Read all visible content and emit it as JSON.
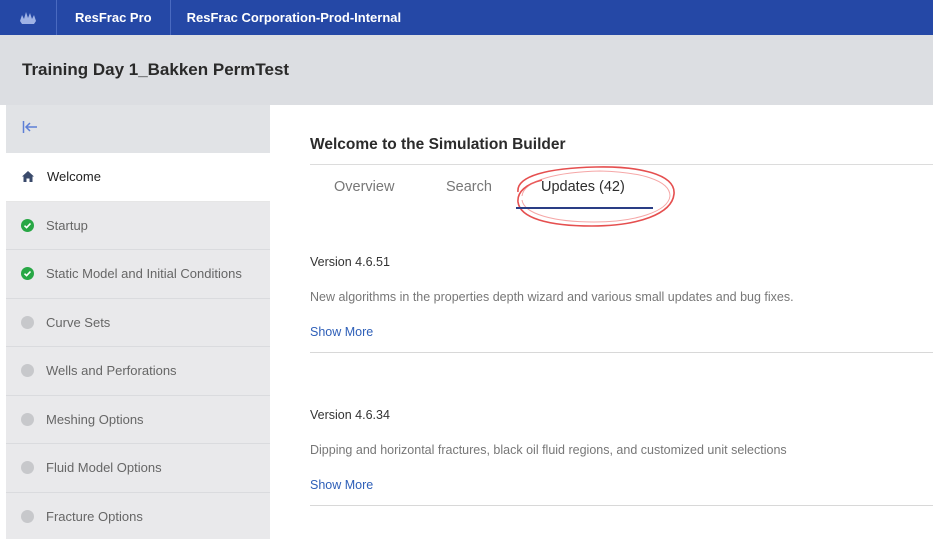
{
  "topbar": {
    "logo_icon": "resfrac-logo-icon",
    "product": "ResFrac Pro",
    "organization": "ResFrac Corporation-Prod-Internal",
    "bg_color": "#2548a6"
  },
  "project": {
    "title": "Training Day 1_Bakken PermTest"
  },
  "sidebar": {
    "collapse_icon": "collapse-left-icon",
    "items": [
      {
        "label": "Welcome",
        "status": "active",
        "icon": "home-icon"
      },
      {
        "label": "Startup",
        "status": "complete",
        "icon": "check-circle-icon"
      },
      {
        "label": "Static Model and Initial Conditions",
        "status": "complete",
        "icon": "check-circle-icon"
      },
      {
        "label": "Curve Sets",
        "status": "incomplete",
        "icon": "gray-dot-icon"
      },
      {
        "label": "Wells and Perforations",
        "status": "incomplete",
        "icon": "gray-dot-icon"
      },
      {
        "label": "Meshing Options",
        "status": "incomplete",
        "icon": "gray-dot-icon"
      },
      {
        "label": "Fluid Model Options",
        "status": "incomplete",
        "icon": "gray-dot-icon"
      },
      {
        "label": "Fracture Options",
        "status": "incomplete",
        "icon": "gray-dot-icon"
      }
    ]
  },
  "main": {
    "title": "Welcome to the Simulation Builder",
    "tabs": [
      {
        "label": "Overview",
        "active": false
      },
      {
        "label": "Search",
        "active": false
      },
      {
        "label": "Updates (42)",
        "active": true
      }
    ],
    "updates": [
      {
        "version": "Version 4.6.51",
        "description": "New algorithms in the properties depth wizard and various small updates and bug fixes.",
        "link": "Show More"
      },
      {
        "version": "Version 4.6.34",
        "description": "Dipping and horizontal fractures, black oil fluid regions, and customized unit selections",
        "link": "Show More"
      }
    ]
  },
  "colors": {
    "accent": "#2548a6",
    "complete": "#28a745",
    "link": "#2e5fb8",
    "annotation": "#e03030"
  }
}
